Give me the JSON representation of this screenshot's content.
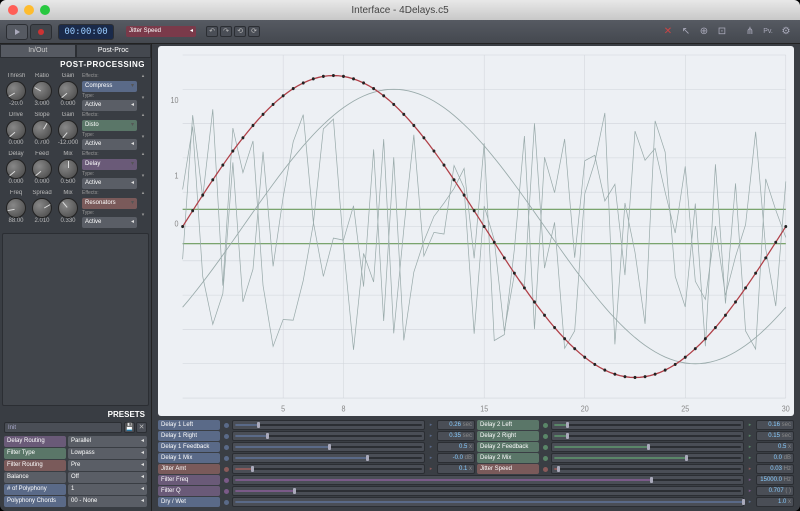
{
  "window": {
    "title": "Interface - 4Delays.c5"
  },
  "transport": {
    "timecode": "00:00:00"
  },
  "tabs": {
    "left": "In/Out",
    "right": "Post-Proc"
  },
  "postprocessing": {
    "header": "POST-PROCESSING",
    "rows": [
      {
        "knobs": [
          {
            "label": "Thresh",
            "value": "-20.0",
            "rot": -120
          },
          {
            "label": "Ratio",
            "value": "3.000",
            "rot": -60
          },
          {
            "label": "Gain",
            "value": "0.000",
            "rot": -130
          }
        ],
        "effect": "Compress",
        "type": "Active",
        "color": "row-blue"
      },
      {
        "knobs": [
          {
            "label": "Drive",
            "value": "0.000",
            "rot": -130
          },
          {
            "label": "Slope",
            "value": "0.700",
            "rot": 30
          },
          {
            "label": "Gain",
            "value": "-12.000",
            "rot": -140
          }
        ],
        "effect": "Disto",
        "type": "Active",
        "color": "row-green"
      },
      {
        "knobs": [
          {
            "label": "Delay",
            "value": "0.000",
            "rot": -130
          },
          {
            "label": "Feed",
            "value": "0.000",
            "rot": -130
          },
          {
            "label": "Mix",
            "value": "0.500",
            "rot": 0
          }
        ],
        "effect": "Delay",
        "type": "Active",
        "color": "row-purple"
      },
      {
        "knobs": [
          {
            "label": "Freq",
            "value": "88.00",
            "rot": -100
          },
          {
            "label": "Spread",
            "value": "2.010",
            "rot": 60
          },
          {
            "label": "Mix",
            "value": "0.330",
            "rot": -40
          }
        ],
        "effect": "Resonators",
        "type": "Active",
        "color": "row-maroon"
      }
    ],
    "ctrl_labels": {
      "effects": "Effects:",
      "type": "Type:"
    }
  },
  "presets": {
    "header": "PRESETS",
    "selected": "Init",
    "rows": [
      {
        "label": "Delay Routing",
        "value": "Parallel",
        "color": "row-purple"
      },
      {
        "label": "Filter Type",
        "value": "Lowpass",
        "color": "row-green"
      },
      {
        "label": "Filter Routing",
        "value": "Pre",
        "color": "row-maroon"
      },
      {
        "label": "Balance",
        "value": "Off",
        "color": "row-gray"
      },
      {
        "label": "# of Polyphony",
        "value": "1",
        "color": "row-blue"
      },
      {
        "label": "Polyphony Chords",
        "value": "00 - None",
        "color": "row-blue"
      }
    ]
  },
  "graph": {
    "param": "Jitter Speed",
    "ylim_top": 10,
    "ylim_mid": 1,
    "xticks": [
      "5",
      "8",
      "15",
      "20",
      "25",
      "30"
    ]
  },
  "paramRows": [
    [
      {
        "label": "Delay 1 Left",
        "value": "0.26",
        "unit": "sec",
        "color": "row-blue",
        "pct": 13,
        "on": true
      },
      {
        "label": "Delay 2 Left",
        "value": "0.16",
        "unit": "sec",
        "color": "row-green",
        "pct": 8,
        "on": true
      }
    ],
    [
      {
        "label": "Delay 1 Right",
        "value": "0.35",
        "unit": "sec",
        "color": "row-blue",
        "pct": 18,
        "on": true
      },
      {
        "label": "Delay 2 Right",
        "value": "0.15",
        "unit": "sec",
        "color": "row-green",
        "pct": 8,
        "on": true
      }
    ],
    [
      {
        "label": "Delay 1 Feedback",
        "value": "0.5",
        "unit": "x",
        "color": "row-blue",
        "pct": 50,
        "on": true
      },
      {
        "label": "Delay 2 Feedback",
        "value": "0.5",
        "unit": "x",
        "color": "row-green",
        "pct": 50,
        "on": true
      }
    ],
    [
      {
        "label": "Delay 1 Mix",
        "value": "-0.0",
        "unit": "dB",
        "color": "row-blue",
        "pct": 70,
        "on": true
      },
      {
        "label": "Delay 2 Mix",
        "value": "0.0",
        "unit": "dB",
        "color": "row-green",
        "pct": 70,
        "on": true
      }
    ],
    [
      {
        "label": "Jitter Amt",
        "value": "0.1",
        "unit": "x",
        "color": "row-maroon",
        "pct": 10,
        "on": true
      },
      {
        "label": "Jitter Speed",
        "value": "0.03",
        "unit": "Hz",
        "color": "row-maroon",
        "pct": 3,
        "on": true
      }
    ],
    [
      {
        "label": "Filter Freq",
        "value": "15000.0",
        "unit": "Hz",
        "color": "row-purple",
        "pct": 82,
        "full": true,
        "on": true
      }
    ],
    [
      {
        "label": "Filter Q",
        "value": "0.707",
        "unit": "( )",
        "color": "row-purple",
        "pct": 12,
        "full": true,
        "on": true
      }
    ],
    [
      {
        "label": "Dry / Wet",
        "value": "1.0",
        "unit": "x",
        "color": "row-blue",
        "pct": 100,
        "full": true,
        "on": true
      }
    ]
  ],
  "chart_data": {
    "type": "line",
    "title": "Jitter Speed",
    "xlim": [
      0,
      30
    ],
    "ylim": [
      -25,
      25
    ],
    "y_log_top": 10,
    "xticks": [
      5,
      8,
      15,
      20,
      25,
      30
    ],
    "series": [
      {
        "name": "sine-with-markers",
        "style": "red-dotted",
        "n_points": 61,
        "amplitude": 22,
        "period": 30,
        "phase": 0,
        "note": "sinusoid from 0 at x=0 up to +22 near x≈7.5 back through 0 at x=15 down to -22 near x≈22.5 up toward 0 at x=30"
      },
      {
        "name": "secondary-sine",
        "style": "gray-thin",
        "amplitude": 20,
        "period": 30,
        "phase": 3
      },
      {
        "name": "noise-1",
        "style": "gray-thin",
        "desc": "jagged random walk roughly ±15"
      },
      {
        "name": "noise-2",
        "style": "gray-thin",
        "desc": "jagged random walk roughly ±15"
      },
      {
        "name": "green-ref-upper",
        "style": "green",
        "y": 2.5
      },
      {
        "name": "green-ref-lower",
        "style": "green",
        "y": -2.5
      }
    ]
  }
}
